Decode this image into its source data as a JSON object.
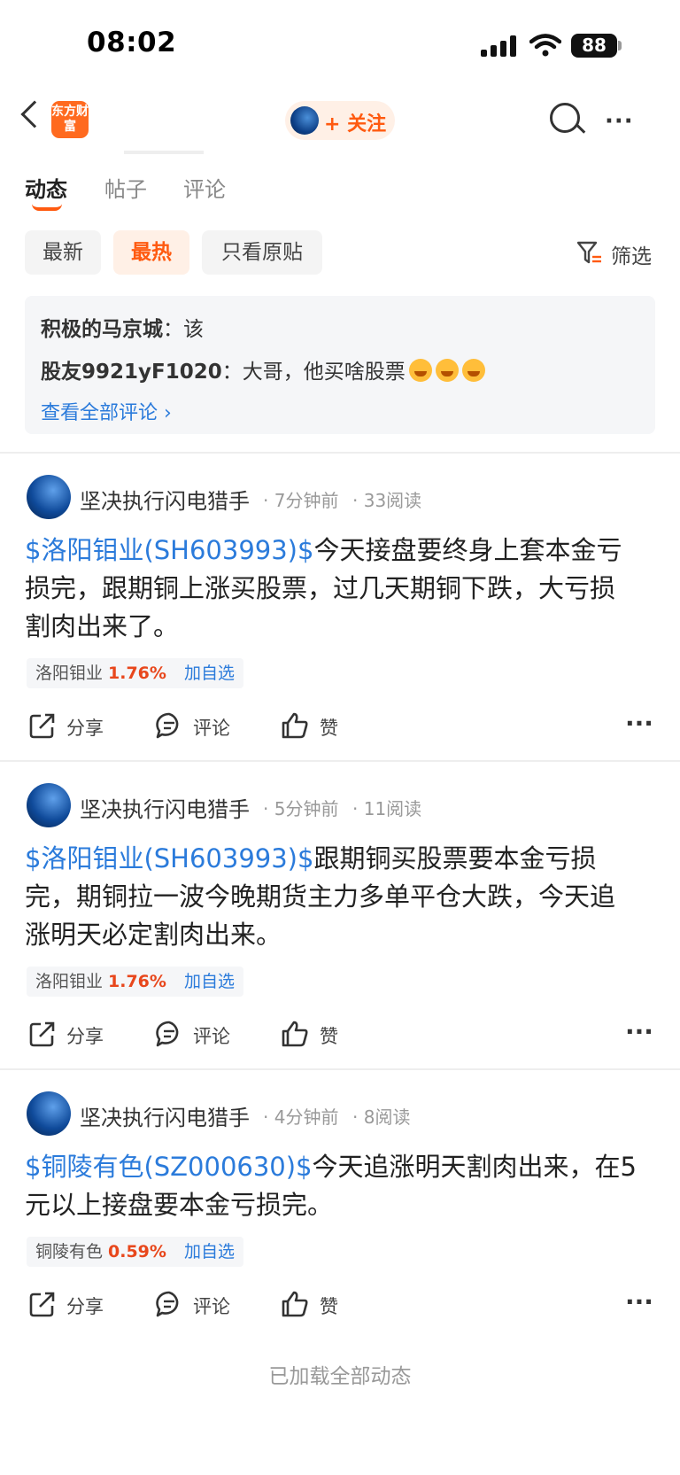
{
  "status_bar": {
    "time": "08:02",
    "battery": "88"
  },
  "header": {
    "logo_text": "东方财富",
    "follow_label": "+ 关注"
  },
  "tabs": [
    {
      "label": "动态",
      "active": true
    },
    {
      "label": "帖子",
      "active": false
    },
    {
      "label": "评论",
      "active": false
    }
  ],
  "filters": {
    "chips": [
      {
        "label": "最新",
        "active": false
      },
      {
        "label": "最热",
        "active": true
      },
      {
        "label": "只看原贴",
        "active": false
      }
    ],
    "filter_label": "筛选"
  },
  "comment_preview": {
    "lines": [
      {
        "user": "积极的马京城",
        "sep": "：",
        "text": "该"
      },
      {
        "user": "股友9921yF1020",
        "sep": "：",
        "text": "大哥，他买啥股票"
      }
    ],
    "view_all": "查看全部评论 ›"
  },
  "posts": [
    {
      "author": "坚决执行闪电猎手",
      "time": "· 7分钟前",
      "reads": "· 33阅读",
      "ticker": "$洛阳钼业(SH603993)$",
      "line1": "今天接盘要终身上套本金亏",
      "line2": "损完，跟期铜上涨买股票，过几天期铜下跌，大亏损",
      "line3": "割肉出来了。",
      "stock_name": "洛阳钼业",
      "stock_pct": "1.76%",
      "add_label": "加自选",
      "share": "分享",
      "comment": "评论",
      "like": "赞"
    },
    {
      "author": "坚决执行闪电猎手",
      "time": "· 5分钟前",
      "reads": "· 11阅读",
      "ticker": "$洛阳钼业(SH603993)$",
      "line1": "跟期铜买股票要本金亏损",
      "line2": "完，期铜拉一波今晚期货主力多单平仓大跌，今天追",
      "line3": "涨明天必定割肉出来。",
      "stock_name": "洛阳钼业",
      "stock_pct": "1.76%",
      "add_label": "加自选",
      "share": "分享",
      "comment": "评论",
      "like": "赞"
    },
    {
      "author": "坚决执行闪电猎手",
      "time": "· 4分钟前",
      "reads": "· 8阅读",
      "ticker": "$铜陵有色(SZ000630)$",
      "line1": "今天追涨明天割肉出来，在5",
      "line2": "元以上接盘要本金亏损完。",
      "line3": "",
      "stock_name": "铜陵有色",
      "stock_pct": "0.59%",
      "add_label": "加自选",
      "share": "分享",
      "comment": "评论",
      "like": "赞"
    }
  ],
  "footer": "已加载全部动态"
}
